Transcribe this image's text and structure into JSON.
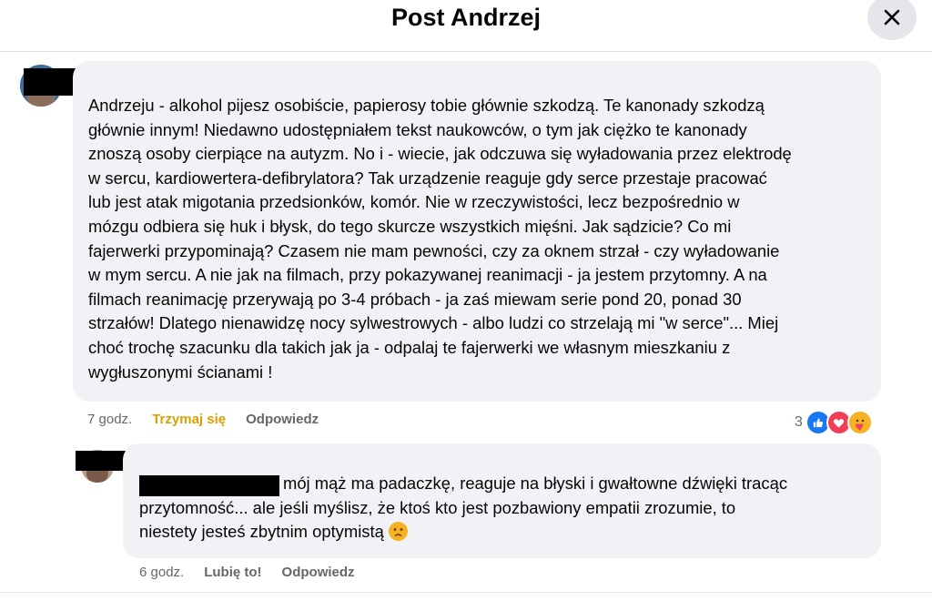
{
  "header": {
    "title": "Post Andrzej",
    "close_icon": "close-icon"
  },
  "comments": [
    {
      "text": "Andrzeju - alkohol pijesz osobiście, papierosy tobie głównie szkodzą. Te kanonady szkodzą\ngłównie innym! Niedawno udostępniałem tekst naukowców, o tym jak ciężko te kanonady\nznoszą osoby cierpiące na autyzm. No i - wiecie, jak odczuwa się wyładowania przez elektrodę\nw sercu, kardiowertera-defibrylatora? Tak urządzenie reaguje gdy serce przestaje pracować\nlub jest atak migotania przedsionków, komór. Nie w rzeczywistości, lecz bezpośrednio w\nmózgu odbiera się huk i błysk, do tego skurcze wszystkich mięśni. Jak sądzicie? Co mi\nfajerwerki przypominają? Czasem nie mam pewności, czy za oknem strzał - czy wyładowanie\nw mym sercu. A nie jak na filmach, przy pokazywanej reanimacji - ja jestem przytomny. A na\nfilmach reanimację przerywają po 3-4 próbach - ja zaś miewam serie pond 20, ponad 30\nstrzałów! Dlatego nienawidzę nocy sylwestrowych - albo ludzi co strzelają mi \"w serce\"... Miej\nchoć trochę szacunku dla takich jak ja - odpalaj te fajerwerki we własnym mieszkaniu z\nwygłuszonymi ścianami !",
      "time": "7 godz.",
      "like_label": "Trzymaj się",
      "reply_label": "Odpowiedz",
      "reaction_count": "3",
      "reaction_icons": [
        "like-icon",
        "love-icon",
        "care-icon"
      ]
    },
    {
      "text": "mój mąż ma padaczkę, reaguje na błyski i gwałtowne dźwięki tracąc\nprzytomność... ale jeśli myślisz, że ktoś kto jest pozbawiony empatii zrozumie, to\nniestety jesteś zbytnim optymistą",
      "emoji": "sad-face-emoji",
      "time": "6 godz.",
      "like_label": "Lubię to!",
      "reply_label": "Odpowiedz"
    }
  ],
  "colors": {
    "bubble": "#f0f2f5",
    "meta_text": "#65676b",
    "like_active": "#d8a000",
    "like_blue": "#1877f2",
    "love_red": "#f33e58",
    "care_yellow": "#f7b125"
  }
}
